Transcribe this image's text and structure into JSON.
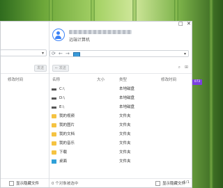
{
  "window": {
    "maximize_glyph": "□",
    "close_glyph": "✕"
  },
  "remote": {
    "device_label": "远端计算机"
  },
  "left_pane": {
    "send_label": "发送",
    "columns": [
      "修改时间"
    ],
    "show_hidden": "显示隐藏文件"
  },
  "right_pane": {
    "send_label": "发送",
    "columns": {
      "name": "名称",
      "size": "大小",
      "type": "类型",
      "modified": "修改时间"
    },
    "rows": [
      {
        "name": "C:\\",
        "type": "本地磁盘",
        "icon": "drive-icon"
      },
      {
        "name": "D:\\",
        "type": "本地磁盘",
        "icon": "drive-icon"
      },
      {
        "name": "E:\\",
        "type": "本地磁盘",
        "icon": "drive-icon"
      },
      {
        "name": "我的视频",
        "type": "文件夹",
        "icon": "folder-icon"
      },
      {
        "name": "我的图片",
        "type": "文件夹",
        "icon": "folder-icon"
      },
      {
        "name": "我的文档",
        "type": "文件夹",
        "icon": "folder-icon"
      },
      {
        "name": "我的音乐",
        "type": "文件夹",
        "icon": "folder-icon"
      },
      {
        "name": "下载",
        "type": "文件夹",
        "icon": "folder-icon"
      },
      {
        "name": "桌面",
        "type": "文件夹",
        "icon": "desktop-icon"
      }
    ],
    "status": "0 个对象被选中",
    "show_hidden": "显示隐藏文件",
    "page_indicator": "1/1"
  },
  "side_badge": "073",
  "colors": {
    "accent": "#3b82f6",
    "folder": "#f5c342",
    "badge": "#7b3fe0"
  }
}
